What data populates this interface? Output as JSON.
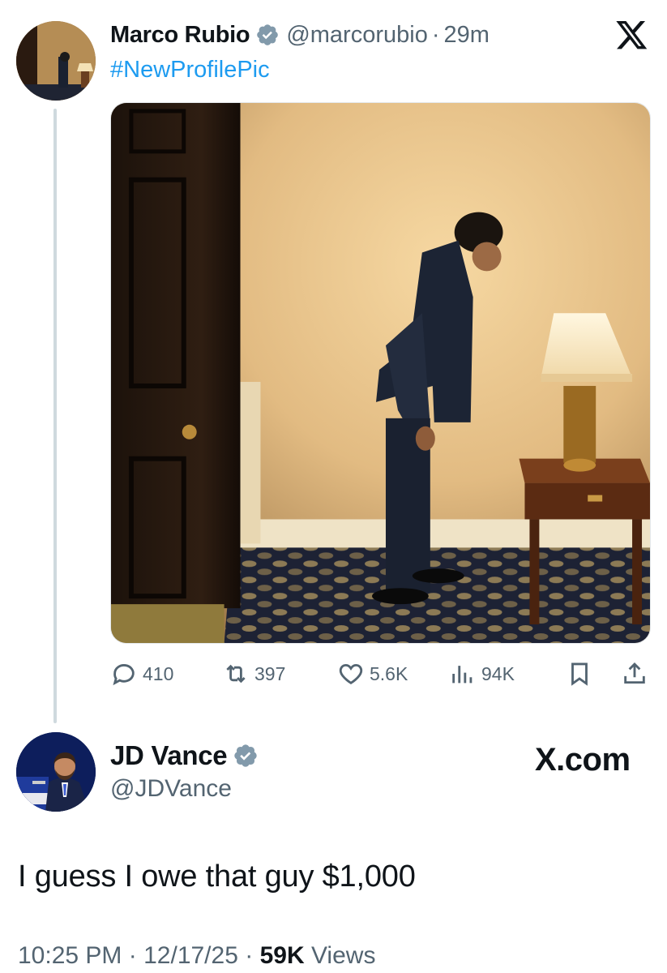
{
  "quoted_tweet": {
    "name": "Marco Rubio",
    "handle": "@marcorubio",
    "separator": "·",
    "time": "29m",
    "text": "#NewProfilePic",
    "actions": {
      "replies": "410",
      "reposts": "397",
      "likes": "5.6K",
      "views": "94K"
    }
  },
  "main_tweet": {
    "name": "JD Vance",
    "handle": "@JDVance",
    "watermark": "X.com",
    "text": "I guess I owe that guy $1,000",
    "time": "10:25 PM",
    "separator": "·",
    "date": "12/17/25",
    "views_count": "59K",
    "views_label": "Views"
  },
  "icons": {
    "verified": "verified-badge-icon",
    "x_logo": "x-logo-icon",
    "reply": "reply-icon",
    "repost": "repost-icon",
    "like": "heart-icon",
    "views": "views-chart-icon",
    "bookmark": "bookmark-icon",
    "share": "share-icon"
  },
  "colors": {
    "link": "#1d9bf0",
    "secondary_text": "#536471",
    "primary_text": "#0f1419",
    "verified_gray": "#829aab"
  }
}
